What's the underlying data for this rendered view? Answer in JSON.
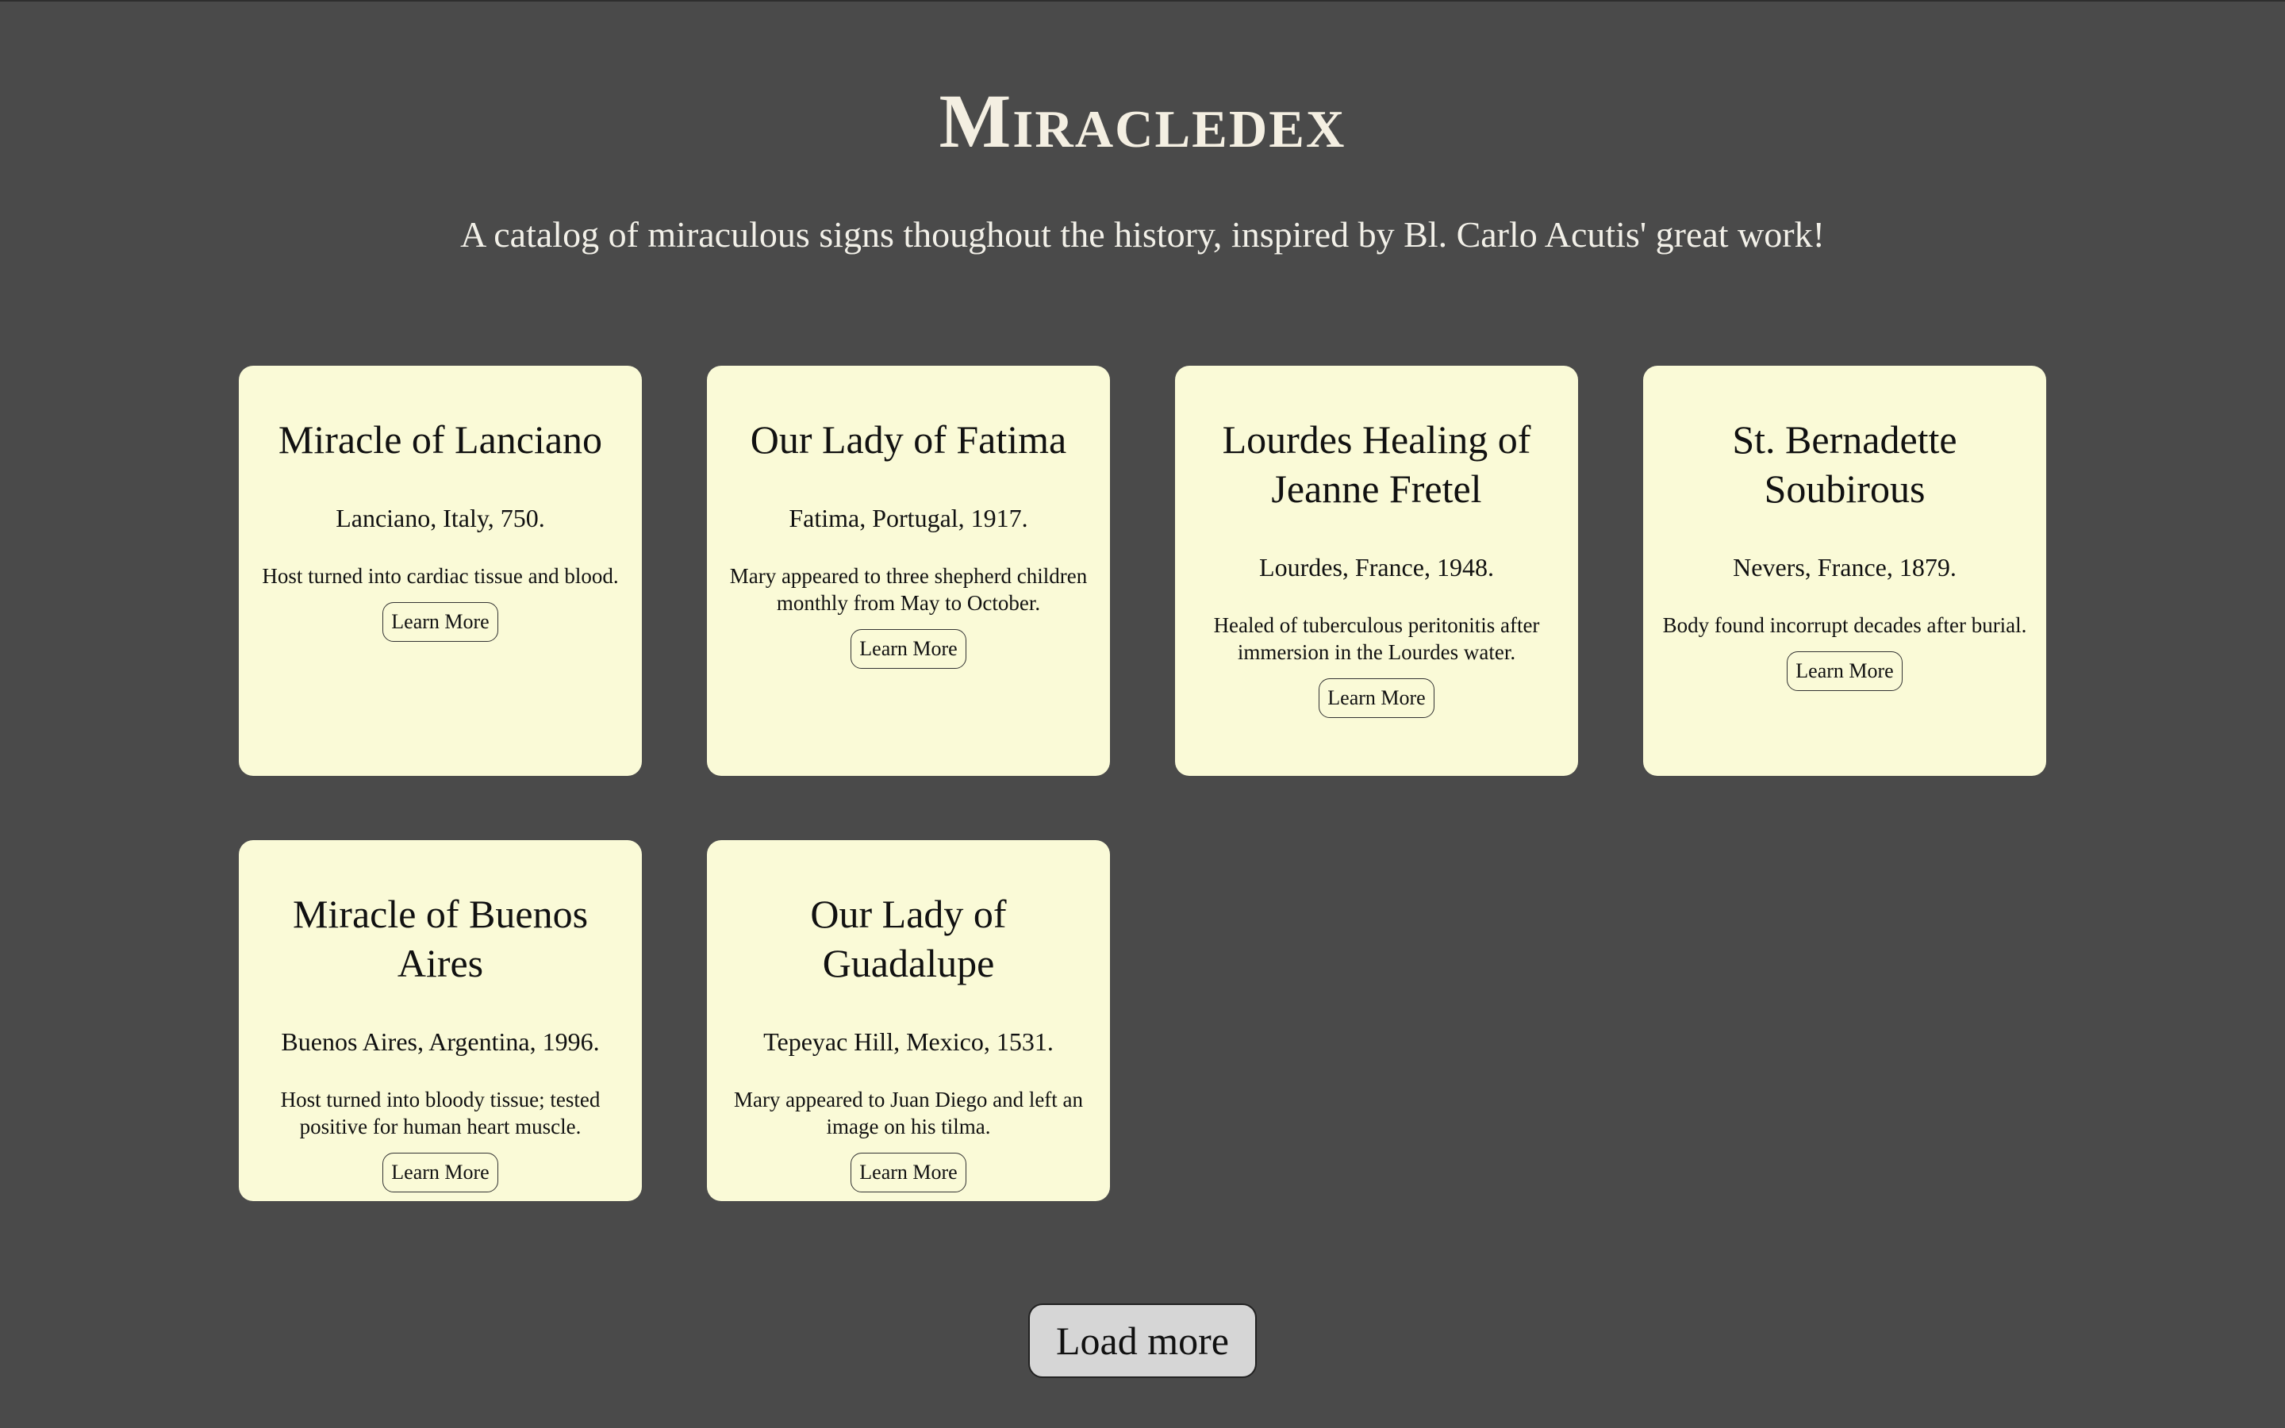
{
  "site": {
    "title": "Miracledex",
    "tagline": "A catalog of miraculous signs thoughout the history, inspired by Bl. Carlo Acutis' great work!"
  },
  "cards": [
    {
      "title": "Miracle of Lanciano",
      "place": "Lanciano, Italy, 750.",
      "description": "Host turned into cardiac tissue and blood.",
      "button": "Learn More"
    },
    {
      "title": "Our Lady of Fatima",
      "place": "Fatima, Portugal, 1917.",
      "description": "Mary appeared to three shepherd children monthly from May to October.",
      "button": "Learn More"
    },
    {
      "title": "Lourdes Healing of Jeanne Fretel",
      "place": "Lourdes, France, 1948.",
      "description": "Healed of tuberculous peritonitis after immersion in the Lourdes water.",
      "button": "Learn More"
    },
    {
      "title": "St. Bernadette Soubirous",
      "place": "Nevers, France, 1879.",
      "description": "Body found incorrupt decades after burial.",
      "button": "Learn More"
    },
    {
      "title": "Miracle of Buenos Aires",
      "place": "Buenos Aires, Argentina, 1996.",
      "description": "Host turned into bloody tissue; tested positive for human heart muscle.",
      "button": "Learn More"
    },
    {
      "title": "Our Lady of Guadalupe",
      "place": "Tepeyac Hill, Mexico, 1531.",
      "description": "Mary appeared to Juan Diego and left an image on his tilma.",
      "button": "Learn More"
    }
  ],
  "load_more": {
    "label": "Load more"
  },
  "colors": {
    "background": "#4a4a4a",
    "card": "#fafad7",
    "title_text": "#f4efe2",
    "load_more_button": "#d6d6d6"
  }
}
